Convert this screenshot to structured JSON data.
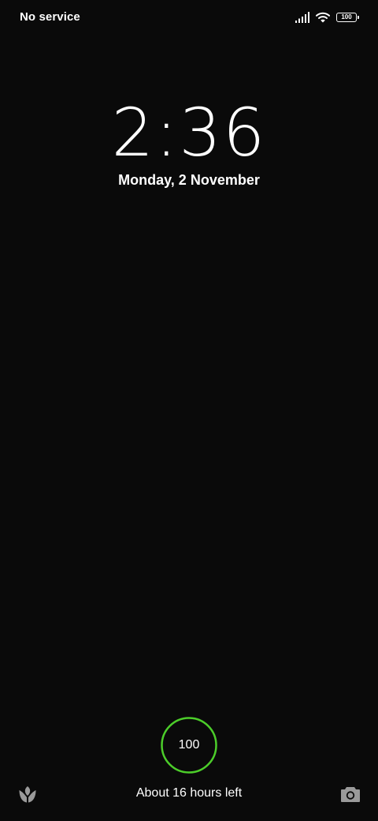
{
  "status_bar": {
    "carrier": "No service",
    "signal_icon": "signal-bars-icon",
    "wifi_icon": "wifi-icon",
    "battery_level": "100"
  },
  "lock_screen": {
    "time": "2:36",
    "date": "Monday, 2 November"
  },
  "charging": {
    "percent": "100",
    "ring_color": "#4ccd2a",
    "time_left": "About 16 hours left"
  },
  "shortcuts": {
    "left_icon": "leaf-icon",
    "right_icon": "camera-icon"
  }
}
